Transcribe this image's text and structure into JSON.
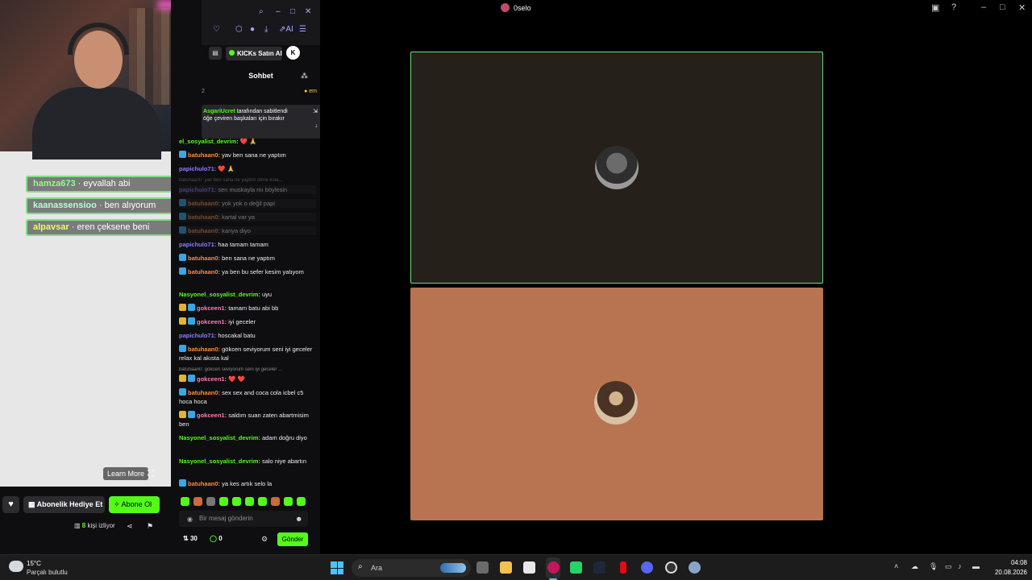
{
  "stream": {
    "overlay_chat": [
      {
        "user": "hamza673",
        "text": "· eyvallah abi"
      },
      {
        "user": "kaanassensioo",
        "text": "· ben alıyorum"
      },
      {
        "user": "alpavsar",
        "text": "· eren çeksene beni"
      }
    ],
    "learn_more": "Learn More",
    "gift_button": "Abonelik Hediye Et",
    "subscribe_button": "Abone Ol",
    "viewer_count": "8",
    "viewer_label": "kişi izliyor"
  },
  "chat": {
    "kicks_button": "KICKs Satın Al",
    "k_logo": "K",
    "title": "Sohbet",
    "pin_count": "2",
    "pin_emote": "em",
    "pinned_user": "AsgariUcret",
    "pinned_by": " tarafından sabitlendi",
    "pinned_text": "öğe çeviren başkaları için bırakır",
    "messages": [
      {
        "user": "el_sosyalist_devrim:",
        "text": " ❤️ 🙏"
      },
      {
        "user": "batuhaan0:",
        "text": " yav ben sana ne yaptım"
      },
      {
        "user": "papichulo71:",
        "text": " ❤️ 🙏"
      },
      {
        "user": "papichulo71:",
        "text": " sen muskayla mı böylesin"
      },
      {
        "user": "batuhaan0:",
        "text": " yok yok o değil papi"
      },
      {
        "user": "batuhaan0:",
        "text": " kartal var ya"
      },
      {
        "user": "batuhaan0:",
        "text": " kanya diyo"
      },
      {
        "user": "papichulo71:",
        "text": " haa tamam tamam"
      },
      {
        "user": "batuhaan0:",
        "text": " ben sana ne yaptım"
      },
      {
        "user": "batuhaan0:",
        "text": " ya ben bu sefer kesim yatıyom"
      },
      {
        "user": "Nasyonel_sosyalist_devrim:",
        "text": " uyu"
      },
      {
        "user": "gokceen1:",
        "text": " tamam batu abi bb"
      },
      {
        "user": "gokceen1:",
        "text": " iyi geceler"
      },
      {
        "user": "papichulo71:",
        "text": " hoscakal batu"
      },
      {
        "user": "batuhaan0:",
        "text": " gökcen seviyorum seni iyi geceler relax kal akısta kal"
      },
      {
        "user": "gokceen1:",
        "text": " ❤️ ❤️"
      },
      {
        "user": "batuhaan0:",
        "text": " sex sex and coca cola icbel c5 hoca hoca"
      },
      {
        "user": "gokceen1:",
        "text": " saldım suan zaten abartmisim ben"
      },
      {
        "user": "Nasyonel_sosyalist_devrim:",
        "text": " adam doğru diyo"
      },
      {
        "user": "Nasyonel_sosyalist_devrim:",
        "text": " salo niye abartın"
      },
      {
        "user": "batuhaan0:",
        "text": " ya kes artık selo la"
      }
    ],
    "replies": [
      "batuhaan0: yav ben sana ne yaptım ömre kola...",
      "batuhaan0: gökcen seviyorum seni iyi geceler ..."
    ],
    "input_placeholder": "Bir mesaj gönderin",
    "kick_count": "30",
    "points": "0",
    "send_button": "Gönder"
  },
  "window": {
    "title": "0selo"
  },
  "taskbar": {
    "temperature": "15°C",
    "weather": "Parçalı bulutlu",
    "search_placeholder": "Ara",
    "time": "04:08",
    "date": "20.08.2026"
  },
  "colors": {
    "kick_green": "#53fc18",
    "tile_top_bg": "#252019",
    "tile_bottom_bg": "#b87350",
    "tile_border": "#6ee07a"
  }
}
